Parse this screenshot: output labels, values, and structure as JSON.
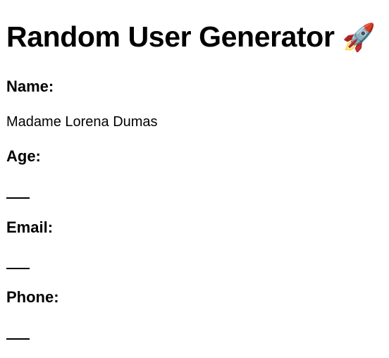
{
  "page": {
    "title": "Random User Generator",
    "title_emoji": "🚀"
  },
  "fields": {
    "name": {
      "label": "Name:",
      "value": "Madame Lorena Dumas"
    },
    "age": {
      "label": "Age:",
      "value": ""
    },
    "email": {
      "label": "Email:",
      "value": ""
    },
    "phone": {
      "label": "Phone:",
      "value": ""
    }
  }
}
